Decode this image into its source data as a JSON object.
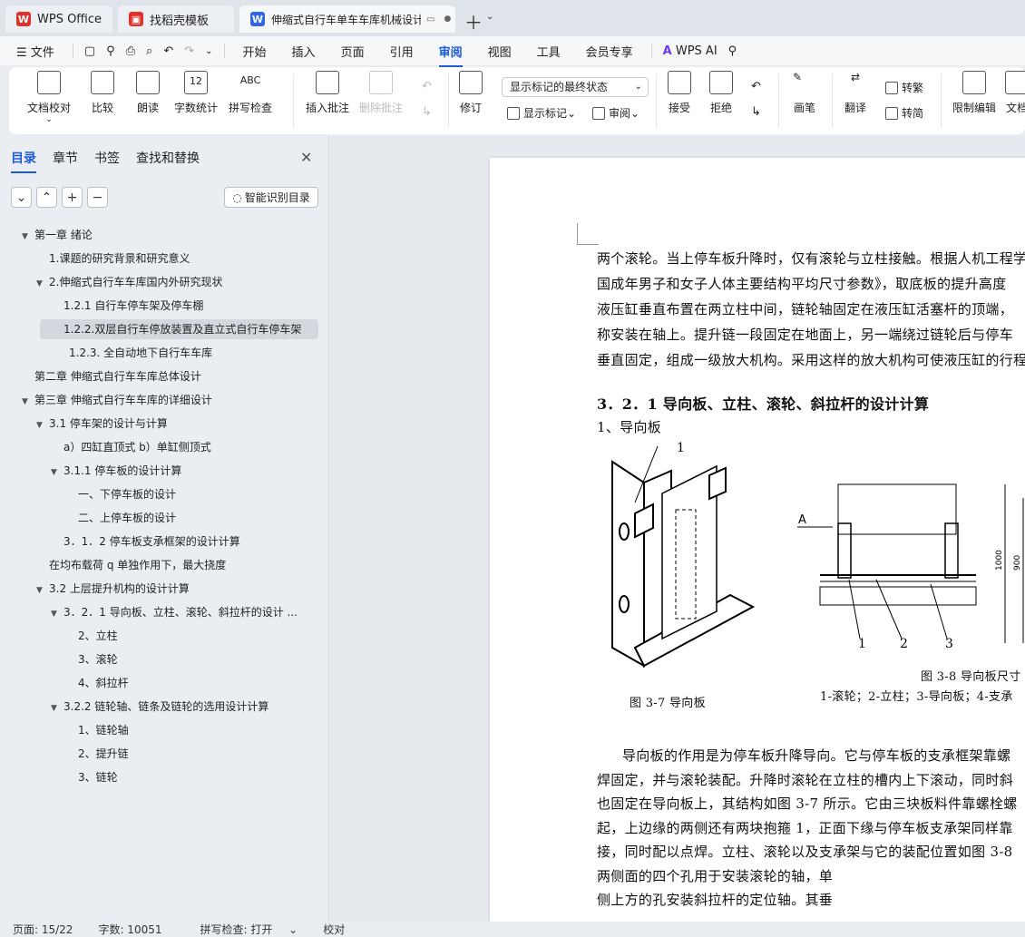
{
  "tabs": [
    {
      "label": "WPS Office"
    },
    {
      "label": "找稻壳模板"
    },
    {
      "label": "伸缩式自行车单车车库机械设计"
    }
  ],
  "menu": {
    "file": "文件",
    "items": [
      "开始",
      "插入",
      "页面",
      "引用",
      "审阅",
      "视图",
      "工具",
      "会员专享"
    ],
    "ai": "WPS AI"
  },
  "ribbon": {
    "proof": "文档校对",
    "compare": "比较",
    "read": "朗读",
    "wordcount": "字数统计",
    "spell": "拼写检查",
    "insert_comment": "插入批注",
    "delete_comment": "删除批注",
    "revise": "修订",
    "markup_select": "显示标记的最终状态",
    "show_markup": "显示标记",
    "review": "审阅",
    "accept": "接受",
    "reject": "拒绝",
    "pen": "画笔",
    "translate": "翻译",
    "to_trad": "转繁",
    "to_simp": "转简",
    "restrict": "限制编辑",
    "doc": "文档",
    "spell_icon_text": "ABC",
    "wc_icon_text": "12"
  },
  "sidebar": {
    "tabs": [
      "目录",
      "章节",
      "书签",
      "查找和替换"
    ],
    "smart": "智能识别目录",
    "toc": [
      {
        "t": "第一章  绪论",
        "arrow": "▼"
      },
      {
        "t": "1.课题的研究背景和研究意义",
        "arrow": ""
      },
      {
        "t": "2.伸缩式自行车车库国内外研究现状",
        "arrow": "▼"
      },
      {
        "t": "1.2.1   自行车停车架及停车棚",
        "arrow": ""
      },
      {
        "t": "1.2.2.双层自行车停放装置及直立式自行车停车架",
        "arrow": ""
      },
      {
        "t": "1.2.3.  全自动地下自行车车库",
        "arrow": ""
      },
      {
        "t": "第二章  伸缩式自行车车库总体设计",
        "arrow": ""
      },
      {
        "t": "第三章  伸缩式自行车车库的详细设计",
        "arrow": "▼"
      },
      {
        "t": "3.1    停车架的设计与计算",
        "arrow": "▼"
      },
      {
        "t": "a）四缸直顶式   b）单缸侧顶式",
        "arrow": ""
      },
      {
        "t": "3.1.1    停车板的设计计算",
        "arrow": "▼"
      },
      {
        "t": "一、下停车板的设计",
        "arrow": ""
      },
      {
        "t": "二、上停车板的设计",
        "arrow": ""
      },
      {
        "t": "3．1．2    停车板支承框架的设计计算",
        "arrow": ""
      },
      {
        "t": "在均布载荷 q 单独作用下，最大挠度",
        "arrow": ""
      },
      {
        "t": "3.2    上层提升机构的设计计算",
        "arrow": "▼"
      },
      {
        "t": "3．2．1    导向板、立柱、滚轮、斜拉杆的设计 ...",
        "arrow": "▼"
      },
      {
        "t": "2、立柱",
        "arrow": ""
      },
      {
        "t": "3、滚轮",
        "arrow": ""
      },
      {
        "t": "4、斜拉杆",
        "arrow": ""
      },
      {
        "t": "3.2.2    链轮轴、链条及链轮的选用设计计算",
        "arrow": "▼"
      },
      {
        "t": "1、链轮轴",
        "arrow": ""
      },
      {
        "t": "2、提升链",
        "arrow": ""
      },
      {
        "t": "3、链轮",
        "arrow": ""
      }
    ]
  },
  "doc": {
    "lines": [
      "两个滚轮。当上停车板升降时，仅有滚轮与立柱接触。根据人机工程学",
      "国成年男子和女子人体主要结构平均尺寸参数》，取底板的提升高度",
      "液压缸垂直布置在两立柱中间，链轮轴固定在液压缸活塞杆的顶端，",
      "称安装在轴上。提升链一段固定在地面上，另一端绕过链轮后与停车",
      "垂直固定，组成一级放大机构。采用这样的放大机构可使液压缸的行程"
    ],
    "heading": "3．2．1   导向板、立柱、滚轮、斜拉杆的设计计算",
    "sub": "1、导向板",
    "fig7_caption": "图 3-7   导向板",
    "fig8_caption": "图 3-8  导向板尺寸",
    "fig8_legend": "1-滚轮；2-立柱；3-导向板；4-支承",
    "fig_labels": {
      "l1": "1",
      "a": "A",
      "n1": "1",
      "n2": "2",
      "n3": "3",
      "d1000": "1000",
      "d900": "900"
    },
    "para": [
      "导向板的作用是为停车板升降导向。它与停车板的支承框架靠螺",
      "焊固定，并与滚轮装配。升降时滚轮在立柱的槽内上下滚动，同时斜",
      "也固定在导向板上，其结构如图 3-7 所示。它由三块板料件靠螺栓螺",
      "起，上边缘的两侧还有两块抱箍 1，正面下缘与停车板支承架同样靠",
      "接，同时配以点焊。立柱、滚轮以及支承架与它的装配位置如图 3-8",
      "两侧面的四个孔用于安装滚轮的轴，单",
      "侧上方的孔安装斜拉杆的定位轴。其垂"
    ]
  },
  "status": {
    "page": "页面: 15/22",
    "words": "字数: 10051",
    "spell": "拼写检查: 打开",
    "proof": "校对"
  }
}
